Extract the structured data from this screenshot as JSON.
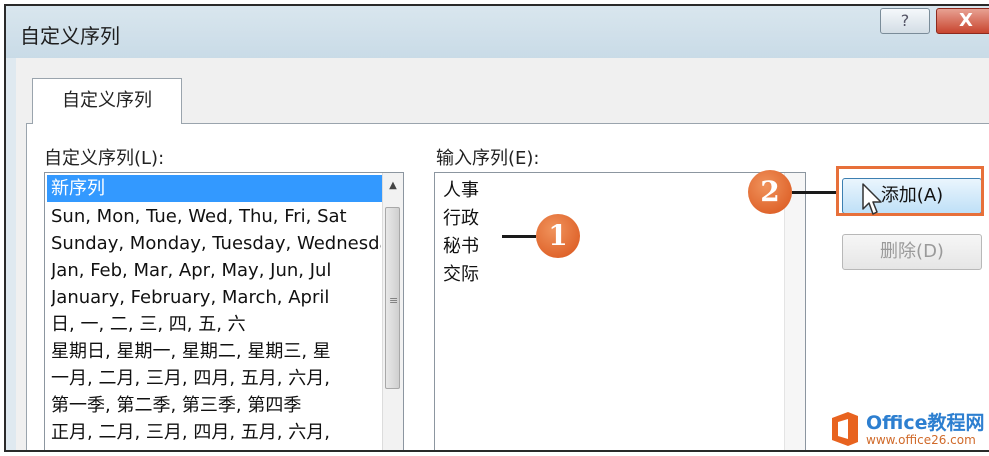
{
  "dialog": {
    "title": "自定义序列",
    "help_glyph": "?",
    "close_glyph": "X"
  },
  "tabs": [
    {
      "label": "自定义序列",
      "active": true
    }
  ],
  "left_panel": {
    "label": "自定义序列(L):",
    "items": [
      "新序列",
      "Sun, Mon, Tue, Wed, Thu, Fri, Sat",
      "Sunday, Monday, Tuesday, Wednesday",
      "Jan, Feb, Mar, Apr, May, Jun, Jul",
      "January, February, March, April",
      "日, 一, 二, 三, 四, 五, 六",
      "星期日, 星期一, 星期二, 星期三, 星",
      "一月, 二月, 三月, 四月, 五月, 六月,",
      "第一季, 第二季, 第三季, 第四季",
      "正月, 二月, 三月, 四月, 五月, 六月,"
    ],
    "selected_index": 0
  },
  "right_panel": {
    "label": "输入序列(E):",
    "lines": [
      "人事",
      "行政",
      "秘书",
      "交际"
    ]
  },
  "buttons": {
    "add": "添加(A)",
    "delete": "删除(D)"
  },
  "callouts": [
    "1",
    "2"
  ],
  "watermark": {
    "title": "Office教程网",
    "url": "www.office26.com"
  },
  "colors": {
    "highlight": "#e7703a",
    "selection": "#3399ff",
    "callout": "#d9531a"
  }
}
